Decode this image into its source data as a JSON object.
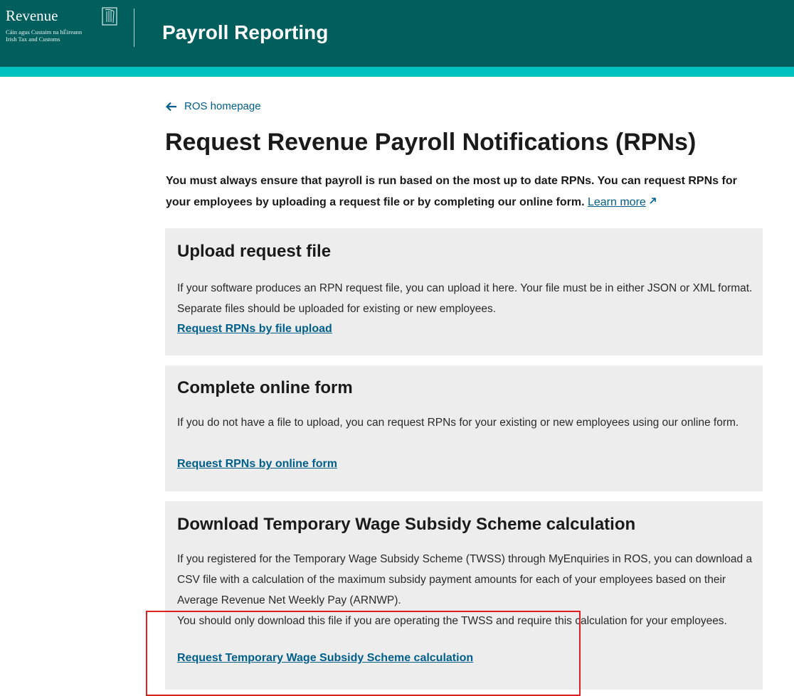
{
  "header": {
    "logo_name": "Revenue",
    "logo_line1": "Cáin agus Custaim na hÉireann",
    "logo_line2": "Irish Tax and Customs",
    "app_title": "Payroll Reporting",
    "bg_color": "#005e5d",
    "stripe_color": "#00c1bd"
  },
  "nav": {
    "back_label": "ROS homepage",
    "back_icon": "arrow-left-icon"
  },
  "page": {
    "title": "Request Revenue Payroll Notifications (RPNs)",
    "intro": "You must always ensure that payroll is run based on the most up to date RPNs. You can request RPNs for your employees by uploading a request file or by completing our online form.",
    "learn_more": "Learn more",
    "learn_more_icon": "external-link-icon",
    "link_color": "#005e8a"
  },
  "cards": [
    {
      "title": "Upload request file",
      "body": "If your software produces an RPN request file, you can upload it here. Your file must be in either JSON or XML format. Separate files should be uploaded for existing or new employees.",
      "link": "Request RPNs by file upload"
    },
    {
      "title": "Complete online form",
      "body": "If you do not have a file to upload, you can request RPNs for your existing or new employees using our online form.",
      "link": "Request RPNs by online form"
    },
    {
      "title": "Download Temporary Wage Subsidy Scheme calculation",
      "body": "If you registered for the Temporary Wage Subsidy Scheme (TWSS) through MyEnquiries in ROS, you can download a CSV file with a calculation of the maximum subsidy payment amounts for each of your employees based on their Average Revenue Net Weekly Pay (ARNWP).",
      "body2": "You should only download this file if you are operating the TWSS and require this calculation for your employees.",
      "link": "Request Temporary Wage Subsidy Scheme calculation"
    }
  ],
  "annotation": {
    "highlight_color": "#e02020"
  }
}
